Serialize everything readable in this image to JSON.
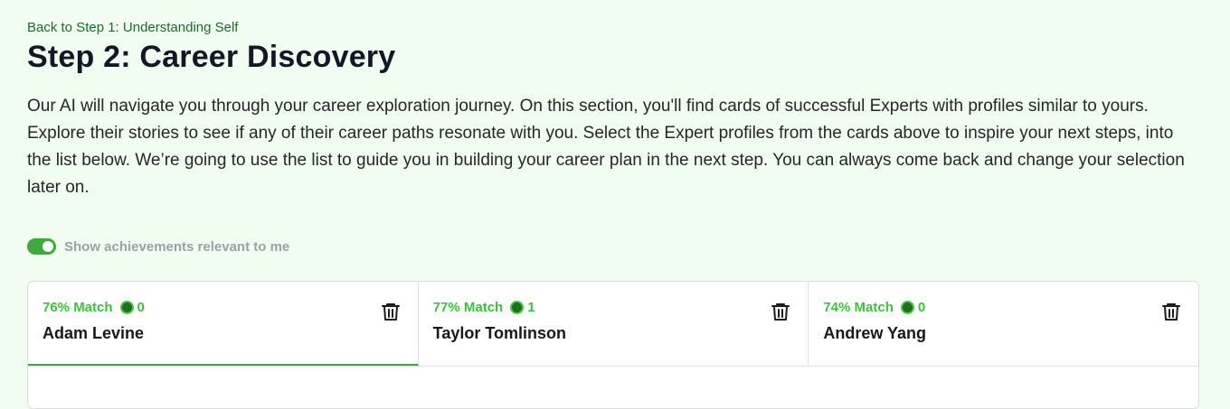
{
  "back_link": "Back to Step 1: Understanding Self",
  "title": "Step 2: Career Discovery",
  "intro": "Our AI will navigate you through your career exploration journey. On this section, you'll find cards of successful Experts with profiles similar to yours. Explore their stories to see if any of their career paths resonate with you. Select the Expert profiles from the cards above to inspire your next steps, into the list below. We’re going to use the list to guide you in building your career plan in the next step. You can always come back and change your selection later on.",
  "toggle": {
    "label": "Show achievements relevant to me",
    "on": true
  },
  "colors": {
    "accent": "#3daa3d",
    "match_text": "#3fbf3f",
    "background": "#f1fdf1"
  },
  "cards": [
    {
      "match": "76% Match",
      "count": "0",
      "name": "Adam Levine",
      "active": true,
      "icon": "trash-icon"
    },
    {
      "match": "77% Match",
      "count": "1",
      "name": "Taylor Tomlinson",
      "active": false,
      "icon": "trash-icon"
    },
    {
      "match": "74% Match",
      "count": "0",
      "name": "Andrew Yang",
      "active": false,
      "icon": "trash-icon"
    }
  ]
}
